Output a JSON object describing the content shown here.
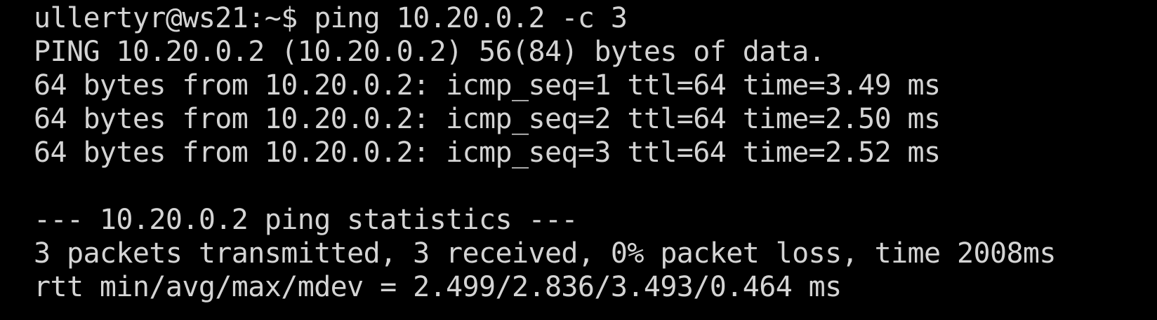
{
  "terminal": {
    "prompt_line": "ullertyr@ws21:~$ ping 10.20.0.2 -c 3",
    "ping_header": "PING 10.20.0.2 (10.20.0.2) 56(84) bytes of data.",
    "reply_1": "64 bytes from 10.20.0.2: icmp_seq=1 ttl=64 time=3.49 ms",
    "reply_2": "64 bytes from 10.20.0.2: icmp_seq=2 ttl=64 time=2.50 ms",
    "reply_3": "64 bytes from 10.20.0.2: icmp_seq=3 ttl=64 time=2.52 ms",
    "stats_header": "--- 10.20.0.2 ping statistics ---",
    "stats_summary": "3 packets transmitted, 3 received, 0% packet loss, time 2008ms",
    "rtt_line": "rtt min/avg/max/mdev = 2.499/2.836/3.493/0.464 ms"
  },
  "colors": {
    "background": "#000000",
    "foreground": "#d4d4d4"
  }
}
